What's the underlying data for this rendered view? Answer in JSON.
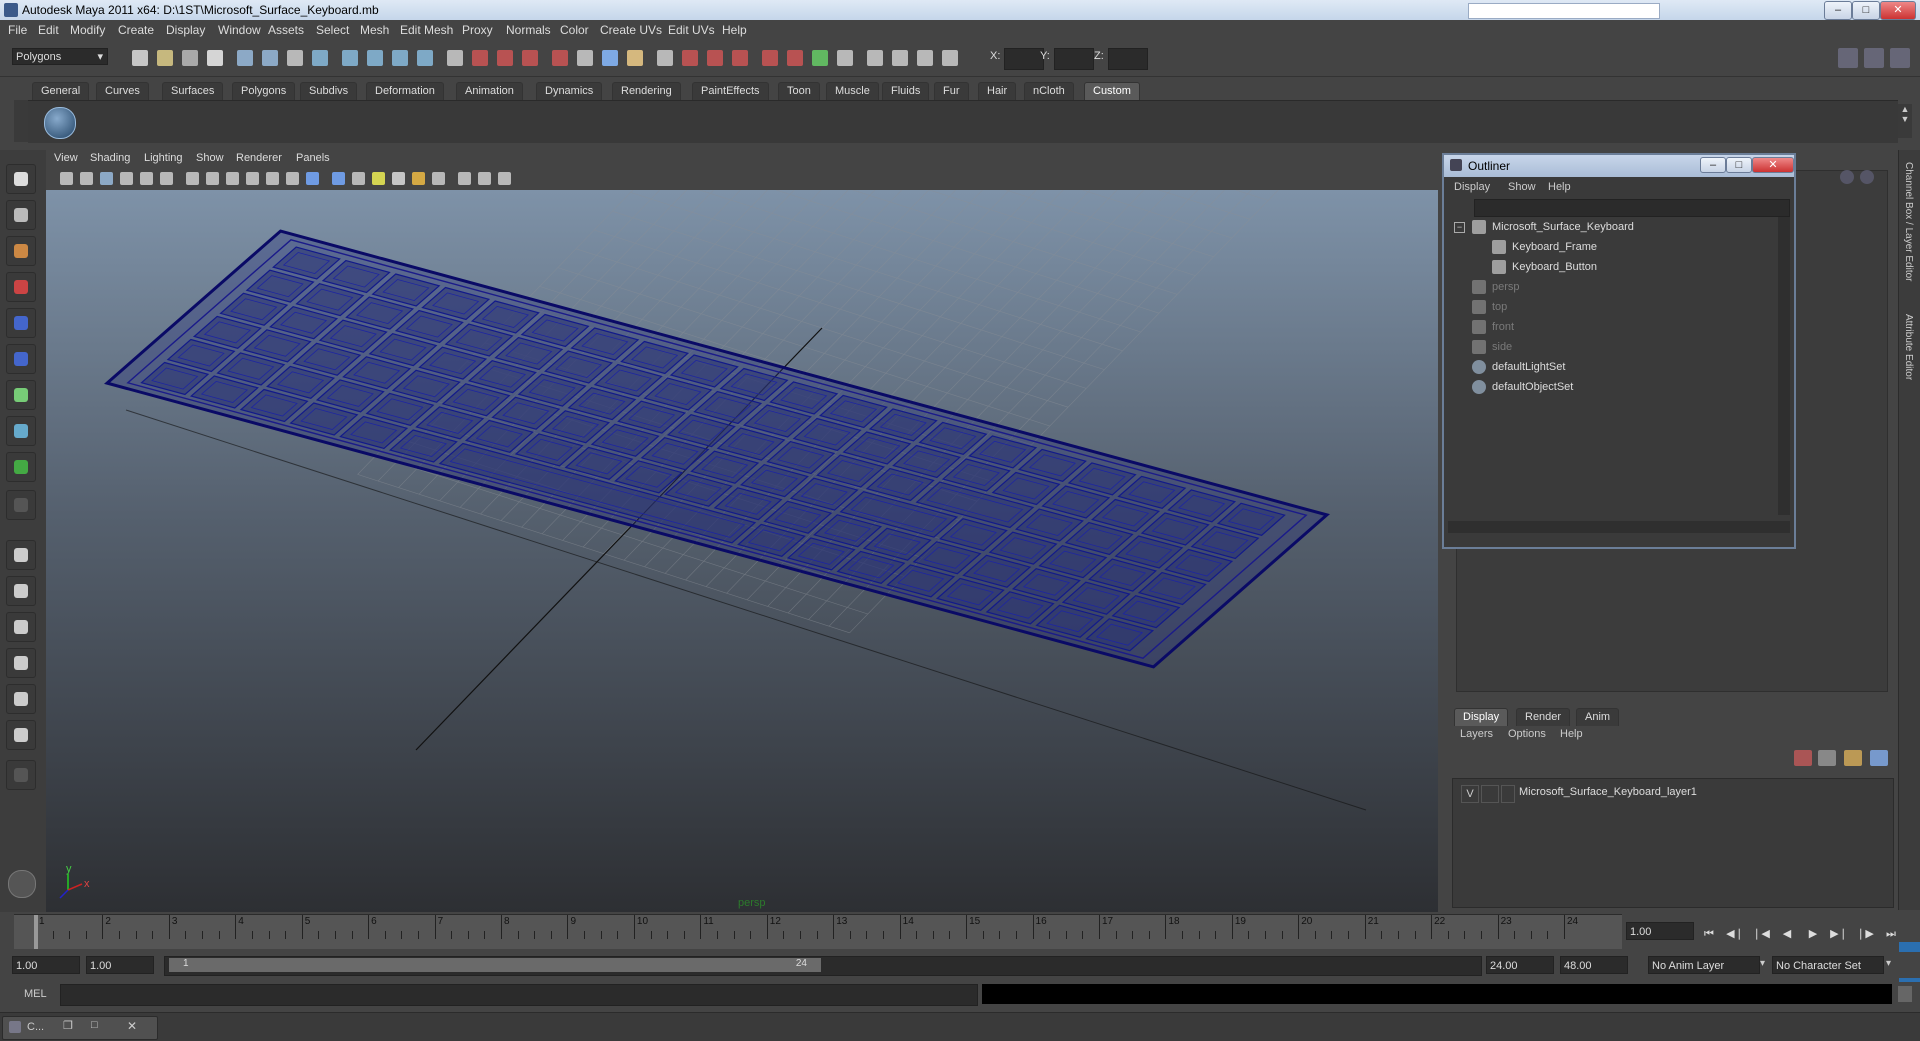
{
  "window": {
    "title": "Autodesk Maya 2011 x64: D:\\1ST\\Microsoft_Surface_Keyboard.mb",
    "minimize_icon": "minimize-icon",
    "maximize_icon": "maximize-icon",
    "close_icon": "close-icon"
  },
  "menubar": [
    "File",
    "Edit",
    "Modify",
    "Create",
    "Display",
    "Window",
    "Assets",
    "Select",
    "Mesh",
    "Edit Mesh",
    "Proxy",
    "Normals",
    "Color",
    "Create UVs",
    "Edit UVs",
    "Help"
  ],
  "toolbar": {
    "mode": "Polygons",
    "coord_labels": [
      "X:",
      "Y:",
      "Z:"
    ]
  },
  "shelf_tabs": [
    "General",
    "Curves",
    "Surfaces",
    "Polygons",
    "Subdivs",
    "Deformation",
    "Animation",
    "Dynamics",
    "Rendering",
    "PaintEffects",
    "Toon",
    "Muscle",
    "Fluids",
    "Fur",
    "Hair",
    "nCloth",
    "Custom"
  ],
  "shelf_active": "Custom",
  "viewport": {
    "menu": [
      "View",
      "Shading",
      "Lighting",
      "Show",
      "Renderer",
      "Panels"
    ],
    "camera_label": "persp",
    "axis_y": "y",
    "axis_x": "x"
  },
  "outliner": {
    "title": "Outliner",
    "menu": [
      "Display",
      "Show",
      "Help"
    ],
    "items": [
      {
        "label": "Microsoft_Surface_Keyboard",
        "depth": 0,
        "dim": false
      },
      {
        "label": "Keyboard_Frame",
        "depth": 1,
        "dim": false
      },
      {
        "label": "Keyboard_Button",
        "depth": 1,
        "dim": false
      },
      {
        "label": "persp",
        "depth": 0,
        "dim": true
      },
      {
        "label": "top",
        "depth": 0,
        "dim": true
      },
      {
        "label": "front",
        "depth": 0,
        "dim": true
      },
      {
        "label": "side",
        "depth": 0,
        "dim": true
      },
      {
        "label": "defaultLightSet",
        "depth": 0,
        "dim": false
      },
      {
        "label": "defaultObjectSet",
        "depth": 0,
        "dim": false
      }
    ]
  },
  "layer_editor": {
    "tabs": [
      "Display",
      "Render",
      "Anim"
    ],
    "menu": [
      "Layers",
      "Options",
      "Help"
    ],
    "layer_visibility": "V",
    "layer_name": "Microsoft_Surface_Keyboard_layer1"
  },
  "side_tabs": [
    "Channel Box / Layer Editor",
    "Attribute Editor"
  ],
  "timeline": {
    "ticks": [
      "1",
      "2",
      "3",
      "4",
      "5",
      "6",
      "7",
      "8",
      "9",
      "10",
      "11",
      "12",
      "13",
      "14",
      "15",
      "16",
      "17",
      "18",
      "19",
      "20",
      "21",
      "22",
      "23",
      "24"
    ],
    "current_frame": "1.00"
  },
  "range": {
    "start_a": "1.00",
    "start_b": "1.00",
    "slider_start": "1",
    "slider_end": "24",
    "end_a": "24.00",
    "end_b": "48.00",
    "anim_layer": "No Anim Layer",
    "character_set": "No Character Set"
  },
  "cmdline": {
    "label": "MEL"
  },
  "taskbar": {
    "label": "C..."
  }
}
